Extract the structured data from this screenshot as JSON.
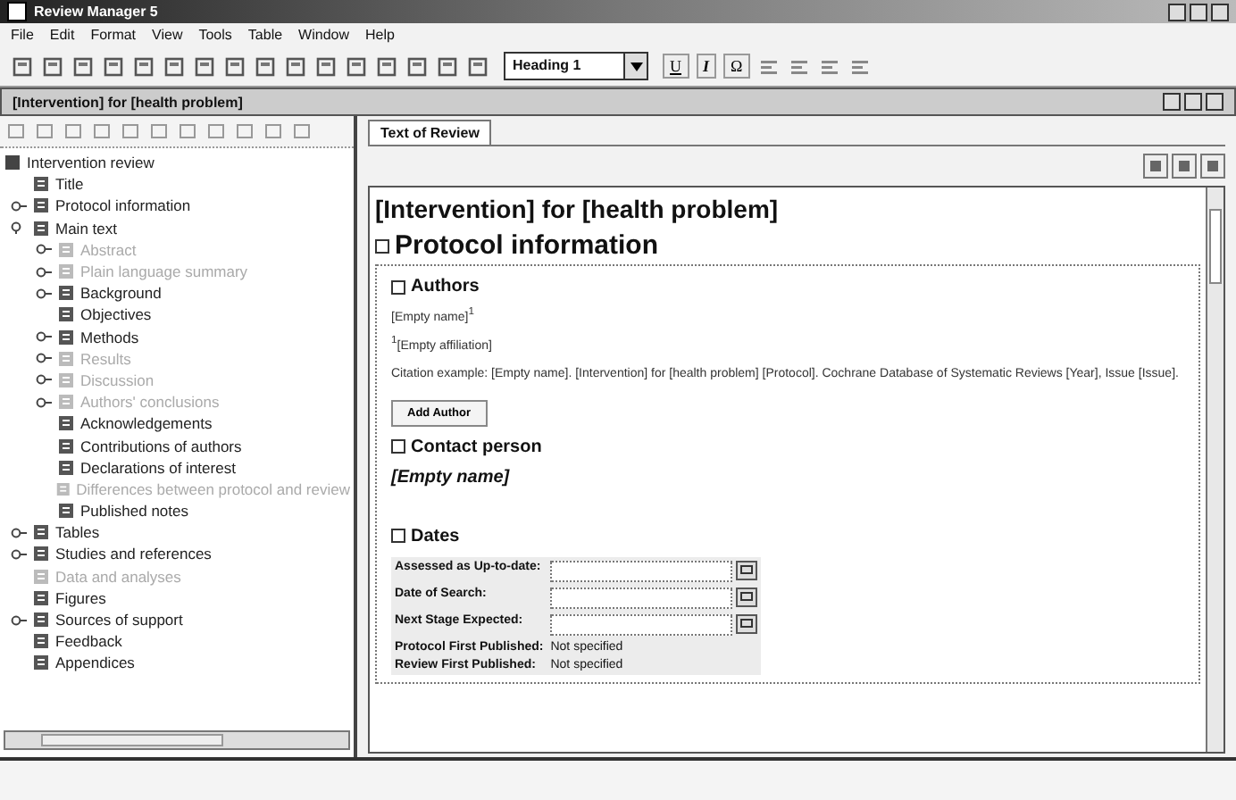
{
  "window": {
    "title": "Review Manager 5"
  },
  "menu": [
    "File",
    "Edit",
    "Format",
    "View",
    "Tools",
    "Table",
    "Window",
    "Help"
  ],
  "toolbar": {
    "style": "Heading 1",
    "format_buttons": [
      "U",
      "I",
      "Ω"
    ]
  },
  "document": {
    "title": "[Intervention] for [health problem]"
  },
  "tree": {
    "label": "Intervention review",
    "children": [
      {
        "label": "Title",
        "disabled": false
      },
      {
        "label": "Protocol information",
        "disabled": false,
        "expanded": false
      },
      {
        "label": "Main text",
        "disabled": false,
        "expanded": true,
        "children": [
          {
            "label": "Abstract",
            "disabled": true,
            "expanded": false
          },
          {
            "label": "Plain language summary",
            "disabled": true,
            "expanded": false
          },
          {
            "label": "Background",
            "disabled": false,
            "expanded": false
          },
          {
            "label": "Objectives",
            "disabled": false
          },
          {
            "label": "Methods",
            "disabled": false,
            "expanded": false
          },
          {
            "label": "Results",
            "disabled": true,
            "expanded": false
          },
          {
            "label": "Discussion",
            "disabled": true,
            "expanded": false
          },
          {
            "label": "Authors' conclusions",
            "disabled": true,
            "expanded": false
          },
          {
            "label": "Acknowledgements",
            "disabled": false
          },
          {
            "label": "Contributions of authors",
            "disabled": false
          },
          {
            "label": "Declarations of interest",
            "disabled": false
          },
          {
            "label": "Differences between protocol and review",
            "disabled": true
          },
          {
            "label": "Published notes",
            "disabled": false
          }
        ]
      },
      {
        "label": "Tables",
        "disabled": false,
        "expanded": false
      },
      {
        "label": "Studies and references",
        "disabled": false,
        "expanded": false
      },
      {
        "label": "Data and analyses",
        "disabled": true
      },
      {
        "label": "Figures",
        "disabled": false
      },
      {
        "label": "Sources of support",
        "disabled": false,
        "expanded": false
      },
      {
        "label": "Feedback",
        "disabled": false
      },
      {
        "label": "Appendices",
        "disabled": false
      }
    ]
  },
  "tabs": [
    {
      "label": "Text of Review",
      "selected": true
    }
  ],
  "review": {
    "title": "[Intervention] for [health problem]",
    "section": "Protocol information",
    "authors": {
      "heading": "Authors",
      "name": "[Empty name]",
      "mark": "1",
      "affiliation_mark": "1",
      "affiliation": "[Empty affiliation]",
      "citation": "Citation example: [Empty name]. [Intervention] for [health problem] [Protocol]. Cochrane Database of Systematic Reviews [Year], Issue [Issue].",
      "button": "Add Author"
    },
    "contact": {
      "heading": "Contact person",
      "name": "[Empty name]"
    },
    "dates": {
      "heading": "Dates",
      "fields": [
        {
          "label": "Assessed as Up-to-date:"
        },
        {
          "label": "Date of Search:"
        },
        {
          "label": "Next Stage Expected:"
        }
      ],
      "values": [
        {
          "label": "Protocol First Published:",
          "value": "Not specified"
        },
        {
          "label": "Review First Published:",
          "value": "Not specified"
        }
      ]
    }
  }
}
